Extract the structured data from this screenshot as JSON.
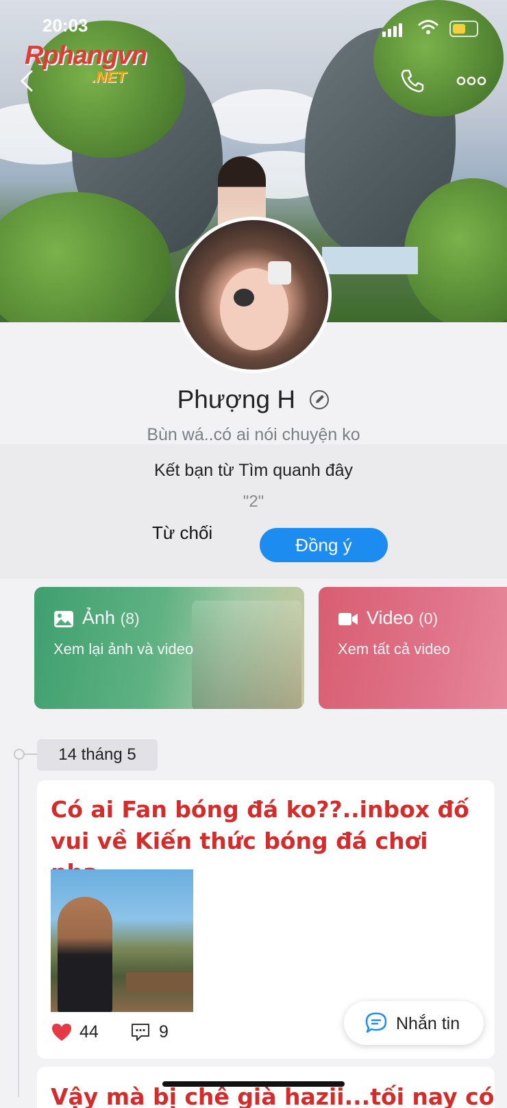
{
  "status_bar": {
    "time": "20:03"
  },
  "watermark": {
    "brand": "Rphangvn",
    "domain": ".NET"
  },
  "profile": {
    "name": "Phượng H",
    "bio": "Bùn wá..có ai nói chuyện ko"
  },
  "friend_request": {
    "source_text": "Kết bạn từ Tìm quanh đây",
    "message": "\"2\"",
    "reject_label": "Từ chối",
    "accept_label": "Đồng ý",
    "accept_color": "#1c8cf0"
  },
  "media_cards": {
    "photos": {
      "title": "Ảnh",
      "count": "(8)",
      "subtitle": "Xem lại ảnh và video",
      "icon": "image-icon",
      "color": "#4caf7a"
    },
    "videos": {
      "title": "Video",
      "count": "(0)",
      "subtitle": "Xem tất cả video",
      "icon": "video-camera-icon",
      "color": "#e0748a"
    }
  },
  "timeline": {
    "date": "14 tháng 5",
    "post": {
      "text": "Có ai Fan bóng đá ko??..inbox đố vui về Kiến thức bóng đá chơi nha",
      "likes": "44",
      "comments": "9",
      "text_color": "#d42b2b"
    },
    "next_post_text": "Vậy mà bị chê già hazii...tối nay có"
  },
  "message_button": {
    "label": "Nhắn tin"
  }
}
